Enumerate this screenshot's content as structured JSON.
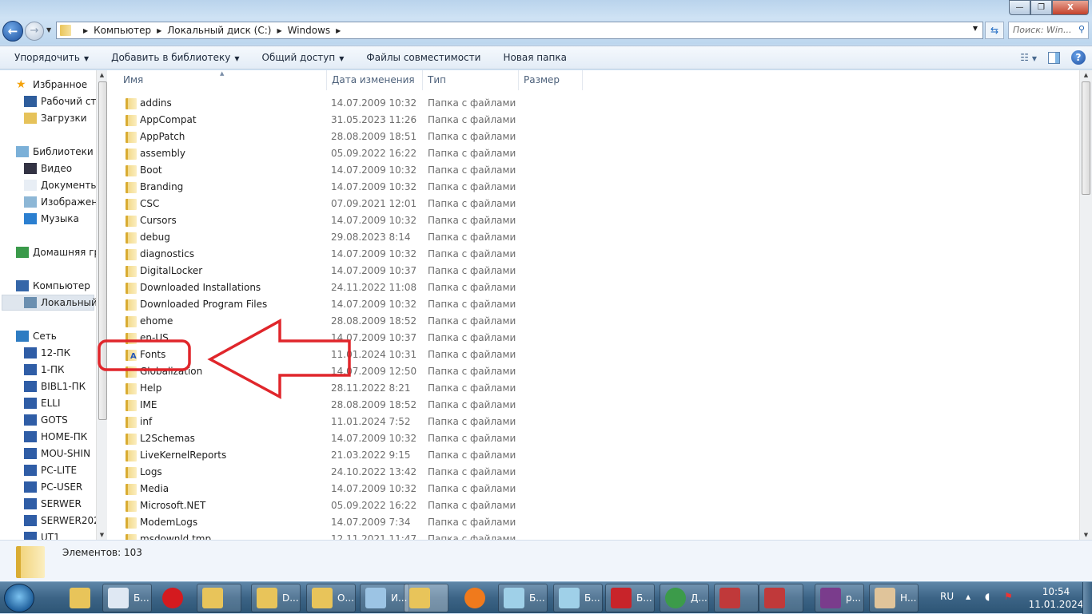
{
  "window": {
    "minimize": "—",
    "maximize": "❐",
    "close": "X"
  },
  "address": {
    "crumbs": [
      "Компьютер",
      "Локальный диск (C:)",
      "Windows"
    ],
    "search_placeholder": "Поиск: Win..."
  },
  "toolbar": {
    "items": [
      {
        "label": "Упорядочить",
        "dropdown": true
      },
      {
        "label": "Добавить в библиотеку",
        "dropdown": true
      },
      {
        "label": "Общий доступ",
        "dropdown": true
      },
      {
        "label": "Файлы совместимости",
        "dropdown": false
      },
      {
        "label": "Новая папка",
        "dropdown": false
      }
    ]
  },
  "nav": {
    "items": [
      {
        "label": "Избранное",
        "icon": "star-icon",
        "level": 0
      },
      {
        "label": "Рабочий стол",
        "icon": "desktop-icon",
        "level": 1
      },
      {
        "label": "Загрузки",
        "icon": "downloads-icon",
        "level": 1
      },
      {
        "label": "Библиотеки",
        "icon": "libraries-icon",
        "level": 0,
        "gap": true
      },
      {
        "label": "Видео",
        "icon": "video-icon",
        "level": 1
      },
      {
        "label": "Документы",
        "icon": "documents-icon",
        "level": 1
      },
      {
        "label": "Изображения",
        "icon": "pictures-icon",
        "level": 1
      },
      {
        "label": "Музыка",
        "icon": "music-icon",
        "level": 1
      },
      {
        "label": "Домашняя группа",
        "icon": "homegroup-icon",
        "level": 0,
        "gap": true
      },
      {
        "label": "Компьютер",
        "icon": "computer-icon",
        "level": 0,
        "gap": true
      },
      {
        "label": "Локальный диск (C:)",
        "icon": "drive-icon",
        "level": 1,
        "selected": true
      },
      {
        "label": "Сеть",
        "icon": "network-icon",
        "level": 0,
        "gap": true
      },
      {
        "label": "12-ПК",
        "icon": "pc-icon",
        "level": 1
      },
      {
        "label": "1-ПК",
        "icon": "pc-icon",
        "level": 1
      },
      {
        "label": "BIBL1-ПК",
        "icon": "pc-icon",
        "level": 1
      },
      {
        "label": "ELLI",
        "icon": "pc-icon",
        "level": 1
      },
      {
        "label": "GOTS",
        "icon": "pc-icon",
        "level": 1
      },
      {
        "label": "HOME-ПК",
        "icon": "pc-icon",
        "level": 1
      },
      {
        "label": "MOU-SHIN",
        "icon": "pc-icon",
        "level": 1
      },
      {
        "label": "PC-LITE",
        "icon": "pc-icon",
        "level": 1
      },
      {
        "label": "PC-USER",
        "icon": "pc-icon",
        "level": 1
      },
      {
        "label": "SERWER",
        "icon": "pc-icon",
        "level": 1
      },
      {
        "label": "SERWER202",
        "icon": "pc-icon",
        "level": 1
      },
      {
        "label": "UT1",
        "icon": "pc-icon",
        "level": 1
      }
    ]
  },
  "columns": [
    "Имя",
    "Дата изменения",
    "Тип",
    "Размер"
  ],
  "files": [
    {
      "name": "addins",
      "date": "14.07.2009 10:32",
      "type": "Папка с файлами"
    },
    {
      "name": "AppCompat",
      "date": "31.05.2023 11:26",
      "type": "Папка с файлами"
    },
    {
      "name": "AppPatch",
      "date": "28.08.2009 18:51",
      "type": "Папка с файлами"
    },
    {
      "name": "assembly",
      "date": "05.09.2022 16:22",
      "type": "Папка с файлами"
    },
    {
      "name": "Boot",
      "date": "14.07.2009 10:32",
      "type": "Папка с файлами"
    },
    {
      "name": "Branding",
      "date": "14.07.2009 10:32",
      "type": "Папка с файлами"
    },
    {
      "name": "CSC",
      "date": "07.09.2021 12:01",
      "type": "Папка с файлами"
    },
    {
      "name": "Cursors",
      "date": "14.07.2009 10:32",
      "type": "Папка с файлами"
    },
    {
      "name": "debug",
      "date": "29.08.2023 8:14",
      "type": "Папка с файлами"
    },
    {
      "name": "diagnostics",
      "date": "14.07.2009 10:32",
      "type": "Папка с файлами"
    },
    {
      "name": "DigitalLocker",
      "date": "14.07.2009 10:37",
      "type": "Папка с файлами"
    },
    {
      "name": "Downloaded Installations",
      "date": "24.11.2022 11:08",
      "type": "Папка с файлами"
    },
    {
      "name": "Downloaded Program Files",
      "date": "14.07.2009 10:32",
      "type": "Папка с файлами"
    },
    {
      "name": "ehome",
      "date": "28.08.2009 18:52",
      "type": "Папка с файлами"
    },
    {
      "name": "en-US",
      "date": "14.07.2009 10:37",
      "type": "Папка с файлами"
    },
    {
      "name": "Fonts",
      "date": "11.01.2024 10:31",
      "type": "Папка с файлами",
      "special": "fonts"
    },
    {
      "name": "Globalization",
      "date": "14.07.2009 12:50",
      "type": "Папка с файлами"
    },
    {
      "name": "Help",
      "date": "28.11.2022 8:21",
      "type": "Папка с файлами"
    },
    {
      "name": "IME",
      "date": "28.08.2009 18:52",
      "type": "Папка с файлами"
    },
    {
      "name": "inf",
      "date": "11.01.2024 7:52",
      "type": "Папка с файлами"
    },
    {
      "name": "L2Schemas",
      "date": "14.07.2009 10:32",
      "type": "Папка с файлами"
    },
    {
      "name": "LiveKernelReports",
      "date": "21.03.2022 9:15",
      "type": "Папка с файлами"
    },
    {
      "name": "Logs",
      "date": "24.10.2022 13:42",
      "type": "Папка с файлами"
    },
    {
      "name": "Media",
      "date": "14.07.2009 10:32",
      "type": "Папка с файлами"
    },
    {
      "name": "Microsoft.NET",
      "date": "05.09.2022 16:22",
      "type": "Папка с файлами"
    },
    {
      "name": "ModemLogs",
      "date": "14.07.2009 7:34",
      "type": "Папка с файлами"
    },
    {
      "name": "msdownld.tmp",
      "date": "12.11.2021 11:47",
      "type": "Папка с файлами"
    }
  ],
  "status": {
    "items_count": "Элементов: 103"
  },
  "taskbar": {
    "buttons": [
      {
        "label": "",
        "icon": "explorer-icon",
        "color": "#e8c45a",
        "plain": true
      },
      {
        "label": "Б...",
        "icon": "word-doc-icon",
        "color": "#dfe8f3"
      },
      {
        "label": "",
        "icon": "opera-icon",
        "color": "#d41a1f",
        "plain": true
      },
      {
        "label": "",
        "icon": "folder-icon",
        "color": "#e8c45a"
      },
      {
        "label": "D...",
        "icon": "downloads-folder-icon",
        "color": "#e8c45a"
      },
      {
        "label": "О...",
        "icon": "folder-icon",
        "color": "#e8c45a"
      },
      {
        "label": "И...",
        "icon": "computer-icon",
        "color": "#9cc4e4"
      },
      {
        "label": "",
        "icon": "folder-icon",
        "color": "#e8c45a",
        "active": true
      },
      {
        "label": "",
        "icon": "firefox-icon",
        "color": "#f07a1c",
        "plain": true
      },
      {
        "label": "Б...",
        "icon": "notepad-icon",
        "color": "#9fd0e8"
      },
      {
        "label": "Б...",
        "icon": "notepad-icon",
        "color": "#9fd0e8"
      },
      {
        "label": "Б...",
        "icon": "pdf-icon",
        "color": "#c8242a"
      },
      {
        "label": "Д...",
        "icon": "chrome-icon",
        "color": "#3c9b4a"
      },
      {
        "label": "",
        "icon": "picture-viewer-icon",
        "color": "#c0393a"
      },
      {
        "label": "",
        "icon": "picture-viewer-icon",
        "color": "#c0393a"
      },
      {
        "label": "р...",
        "icon": "winrar-icon",
        "color": "#7a3c8c"
      },
      {
        "label": "Н...",
        "icon": "paint-icon",
        "color": "#e0c49a"
      }
    ]
  },
  "tray": {
    "language": "RU",
    "time": "10:54",
    "date": "11.01.2024"
  },
  "annotation": {
    "color": "#e0262b"
  }
}
